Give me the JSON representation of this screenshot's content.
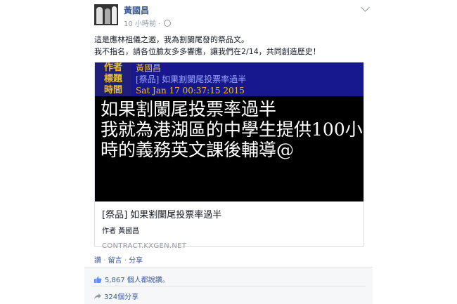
{
  "post": {
    "author": "黃國昌",
    "time": "10 小時前 · ",
    "text_lines": [
      "這是應林祖儀之邀，我為割闌尾發的祭品文。",
      "我不指名，請各位臉友多多響應，讓我們在2/14，共同創造歷史！"
    ]
  },
  "card": {
    "header": [
      {
        "label": "作者",
        "value": "黃國昌",
        "value_color": "#f0c020"
      },
      {
        "label": "標題",
        "value": "[祭品] 如果割闌尾投票率過半",
        "value_color": "#9aa6ff"
      },
      {
        "label": "時間",
        "value": "Sat Jan 17 00:37:15 2015",
        "value_color": "#f0c020"
      }
    ],
    "body_lines": [
      "如果割闌尾投票率過半",
      "我就為港湖區的中學生提供100小",
      "時的義務英文課後輔導@"
    ],
    "title": "[祭品] 如果割闌尾投票率過半",
    "author_line": "作者 黃國昌",
    "domain": "CONTRACT.KXGEN.NET"
  },
  "actions": {
    "like": "讚",
    "comment": "留言",
    "share": "分享"
  },
  "footer": {
    "likes": "5,867 個人都說讚。",
    "shares": "324個分享"
  }
}
